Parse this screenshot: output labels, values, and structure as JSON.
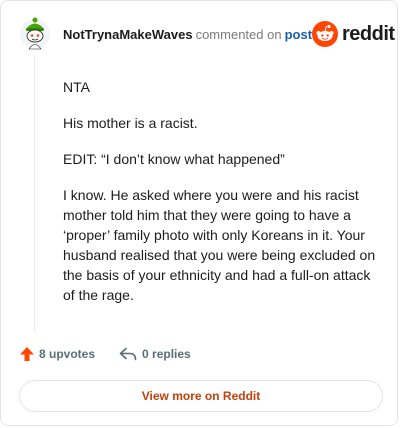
{
  "comment": {
    "author": "NotTrynaMakeWaves",
    "action_text": "commented on",
    "target_link": "post",
    "paragraphs": [
      "NTA",
      "His mother is a racist.",
      "EDIT: “I don’t know what happened”",
      "I know. He asked where you were and his racist mother told him that they were going to have a ‘proper’ family photo with only Koreans in it. Your husband realised that you were being excluded on the basis of your ethnicity and had a full-on attack of the rage."
    ]
  },
  "brand": {
    "wordmark": "reddit",
    "color": "#ff4500"
  },
  "footer": {
    "upvotes_label": "8 upvotes",
    "replies_label": "0 replies",
    "view_button_label": "View more on Reddit"
  },
  "colors": {
    "accent": "#ff4500",
    "link": "#1a5ea8",
    "muted": "#576f76"
  }
}
